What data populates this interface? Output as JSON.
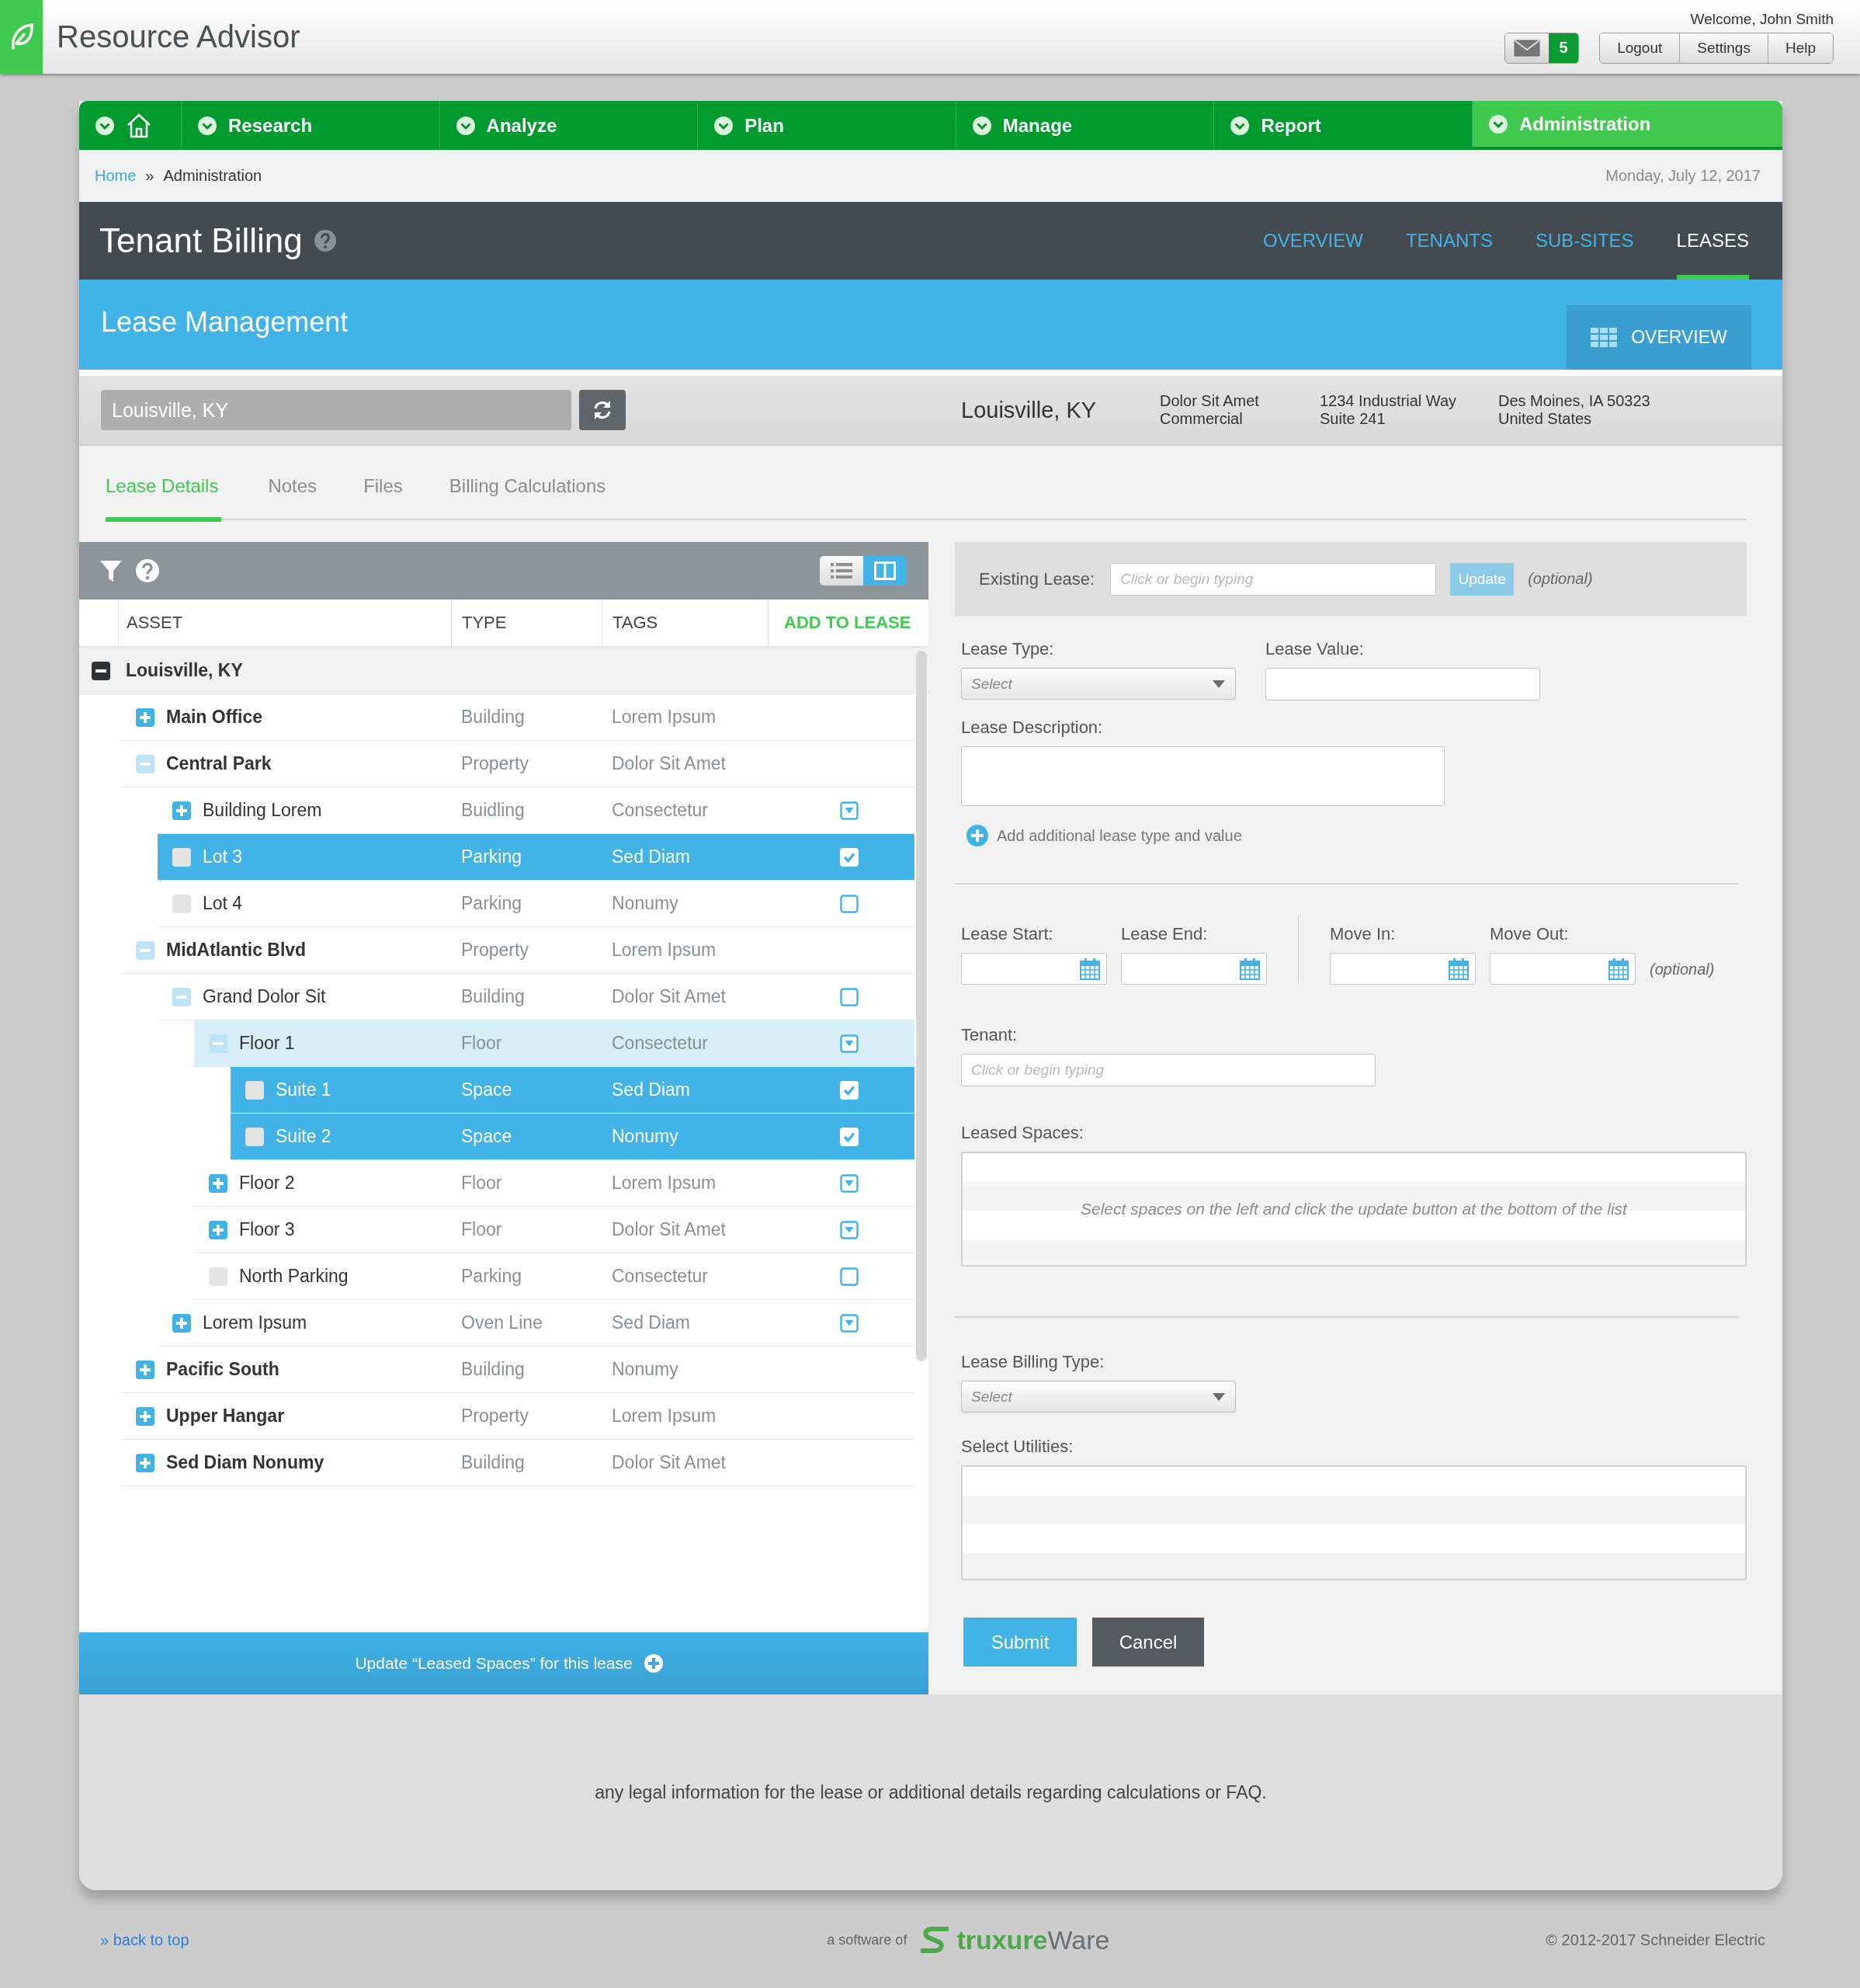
{
  "header": {
    "app_title": "Resource Advisor",
    "welcome": "Welcome, John Smith",
    "message_count": "5",
    "buttons": [
      "Logout",
      "Settings",
      "Help"
    ]
  },
  "nav": [
    {
      "kind": "home",
      "selected": false
    },
    {
      "kind": "section",
      "label": "Research",
      "selected": false
    },
    {
      "kind": "section",
      "label": "Analyze",
      "selected": false
    },
    {
      "kind": "section",
      "label": "Plan",
      "selected": false
    },
    {
      "kind": "section",
      "label": "Manage",
      "selected": false
    },
    {
      "kind": "section",
      "label": "Report",
      "selected": false
    },
    {
      "kind": "section",
      "label": "Administration",
      "selected": true
    }
  ],
  "breadcrumb": {
    "items": [
      "Home",
      "Administration"
    ],
    "separator": "»",
    "date": "Monday, July 12, 2017"
  },
  "page": {
    "title": "Tenant Billing",
    "tabs": [
      {
        "label": "OVERVIEW",
        "selected": false
      },
      {
        "label": "TENANTS",
        "selected": false
      },
      {
        "label": "SUB-SITES",
        "selected": false
      },
      {
        "label": "LEASES",
        "selected": true
      }
    ]
  },
  "banner": {
    "title": "Lease Management",
    "button": "OVERVIEW"
  },
  "location": {
    "value": "Louisville, KY",
    "name": "Louisville, KY",
    "details": [
      [
        "Dolor Sit Amet",
        "Commercial"
      ],
      [
        "1234 Industrial Way",
        "Suite 241"
      ],
      [
        "Des Moines, IA 50323",
        "United States"
      ]
    ]
  },
  "detail_tabs": [
    {
      "label": "Lease Details",
      "selected": true
    },
    {
      "label": "Notes",
      "selected": false
    },
    {
      "label": "Files",
      "selected": false
    },
    {
      "label": "Billing Calculations",
      "selected": false
    }
  ],
  "asset_table": {
    "view_modes": [
      {
        "kind": "list",
        "selected": false
      },
      {
        "kind": "split",
        "selected": true
      }
    ],
    "columns": [
      "ASSET",
      "TYPE",
      "TAGS",
      "ADD TO LEASE"
    ],
    "rows": [
      {
        "asset": "Louisville, KY",
        "kind": "group",
        "expanded": true,
        "selected": false,
        "highlighted": false,
        "children": [
          {
            "asset": "Main Office",
            "type": "Building",
            "tags": "Lorem Ipsum",
            "kind": "group",
            "expanded": false,
            "selected": false,
            "highlighted": false
          },
          {
            "asset": "Central Park",
            "type": "Property",
            "tags": "Dolor Sit Amet",
            "kind": "group",
            "expanded": true,
            "selected": false,
            "highlighted": false,
            "children": [
              {
                "asset": "Building Lorem",
                "type": "Buidling",
                "tags": "Consectetur",
                "kind": "group",
                "expanded": false,
                "selected": false,
                "highlighted": false,
                "checked": false,
                "partial": true
              },
              {
                "asset": "Lot 3",
                "type": "Parking",
                "tags": "Sed Diam",
                "kind": "leaf",
                "selected": true,
                "checked": true
              },
              {
                "asset": "Lot 4",
                "type": "Parking",
                "tags": "Nonumy",
                "kind": "leaf",
                "selected": false,
                "highlighted": false,
                "checked": false,
                "partial": false
              }
            ]
          },
          {
            "asset": "MidAtlantic Blvd",
            "type": "Property",
            "tags": "Lorem Ipsum",
            "kind": "group",
            "expanded": true,
            "selected": false,
            "highlighted": false,
            "children": [
              {
                "asset": "Grand Dolor Sit",
                "type": "Building",
                "tags": "Dolor Sit Amet",
                "kind": "group",
                "expanded": true,
                "selected": false,
                "highlighted": false,
                "checked": false,
                "partial": false,
                "children": [
                  {
                    "asset": "Floor 1",
                    "type": "Floor",
                    "tags": "Consectetur",
                    "kind": "group",
                    "expanded": true,
                    "selected": false,
                    "highlighted": true,
                    "checked": false,
                    "partial": true,
                    "children": [
                      {
                        "asset": "Suite 1",
                        "type": "Space",
                        "tags": "Sed Diam",
                        "kind": "leaf",
                        "selected": true,
                        "checked": true
                      },
                      {
                        "asset": "Suite 2",
                        "type": "Space",
                        "tags": "Nonumy",
                        "kind": "leaf",
                        "selected": true,
                        "checked": true
                      }
                    ]
                  },
                  {
                    "asset": "Floor 2",
                    "type": "Floor",
                    "tags": "Lorem Ipsum",
                    "kind": "group",
                    "expanded": false,
                    "selected": false,
                    "highlighted": false,
                    "checked": false,
                    "partial": true
                  },
                  {
                    "asset": "Floor 3",
                    "type": "Floor",
                    "tags": "Dolor Sit Amet",
                    "kind": "group",
                    "expanded": false,
                    "selected": false,
                    "highlighted": false,
                    "checked": false,
                    "partial": true
                  },
                  {
                    "asset": "North Parking",
                    "type": "Parking",
                    "tags": "Consectetur",
                    "kind": "leaf",
                    "selected": false,
                    "highlighted": false,
                    "checked": false,
                    "partial": false
                  }
                ]
              },
              {
                "asset": "Lorem Ipsum",
                "type": "Oven Line",
                "tags": "Sed Diam",
                "kind": "group",
                "expanded": false,
                "selected": false,
                "highlighted": false,
                "checked": false,
                "partial": true
              }
            ]
          },
          {
            "asset": "Pacific South",
            "type": "Building",
            "tags": "Nonumy",
            "kind": "group",
            "expanded": false,
            "selected": false,
            "highlighted": false
          },
          {
            "asset": "Upper Hangar",
            "type": "Property",
            "tags": "Lorem Ipsum",
            "kind": "group",
            "expanded": false,
            "selected": false,
            "highlighted": false
          },
          {
            "asset": "Sed Diam Nonumy",
            "type": "Building",
            "tags": "Dolor Sit Amet",
            "kind": "group",
            "expanded": false,
            "selected": false,
            "highlighted": false
          }
        ]
      }
    ],
    "update_button": "Update “Leased Spaces” for this lease"
  },
  "lease_form": {
    "existing_lease": {
      "label": "Existing Lease:",
      "placeholder": "Click or begin typing",
      "button": "Update",
      "disabled": true,
      "note": "(optional)"
    },
    "lease_type": {
      "label": "Lease Type:",
      "placeholder": "Select"
    },
    "lease_value": {
      "label": "Lease Value:"
    },
    "lease_description": {
      "label": "Lease Description:"
    },
    "add_link": "Add additional lease type and value",
    "date_groups": [
      [
        {
          "label": "Lease Start:"
        },
        {
          "label": "Lease End:"
        }
      ],
      [
        {
          "label": "Move In:"
        },
        {
          "label": "Move Out:"
        }
      ]
    ],
    "dates_note": "(optional)",
    "tenant": {
      "label": "Tenant:",
      "placeholder": "Click or begin typing"
    },
    "leased_spaces": {
      "label": "Leased Spaces:",
      "empty_message": "Select spaces on the left and click the update button at the bottom of the list"
    },
    "billing_type": {
      "label": "Lease Billing Type:",
      "placeholder": "Select"
    },
    "utilities": {
      "label": "Select Utilities:"
    },
    "buttons": [
      {
        "label": "Submit",
        "kind": "primary"
      },
      {
        "label": "Cancel",
        "kind": "secondary"
      }
    ]
  },
  "legal_note": "any legal information for the lease or additional details regarding calculations or FAQ.",
  "footer": {
    "back_to_top": "» back to top",
    "software_of": "a software of",
    "brand_first": "truxure",
    "brand_second": "Ware",
    "copyright": "© 2012-2017 Schneider Electric"
  }
}
